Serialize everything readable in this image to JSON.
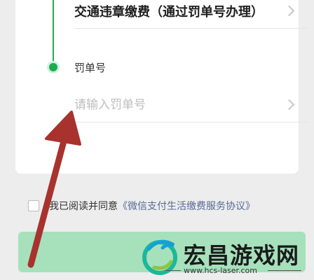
{
  "form": {
    "service_row": {
      "text": "交通违章缴费（通过罚单号办理）"
    },
    "ticket": {
      "label": "罚单号",
      "placeholder": "请输入罚单号",
      "value": ""
    }
  },
  "agreement": {
    "checked": false,
    "prefix": "我已阅读并同意",
    "link": "《微信支付生活缴费服务协议》"
  },
  "submit": {
    "label": ""
  },
  "annotation": {
    "color": "#a8322e"
  },
  "watermark": {
    "title": "宏昌游戏网",
    "url": "www.hcs-laser.com"
  },
  "colors": {
    "accent": "#1aad50",
    "button_disabled": "#a6e1bc",
    "link": "#576b95"
  }
}
